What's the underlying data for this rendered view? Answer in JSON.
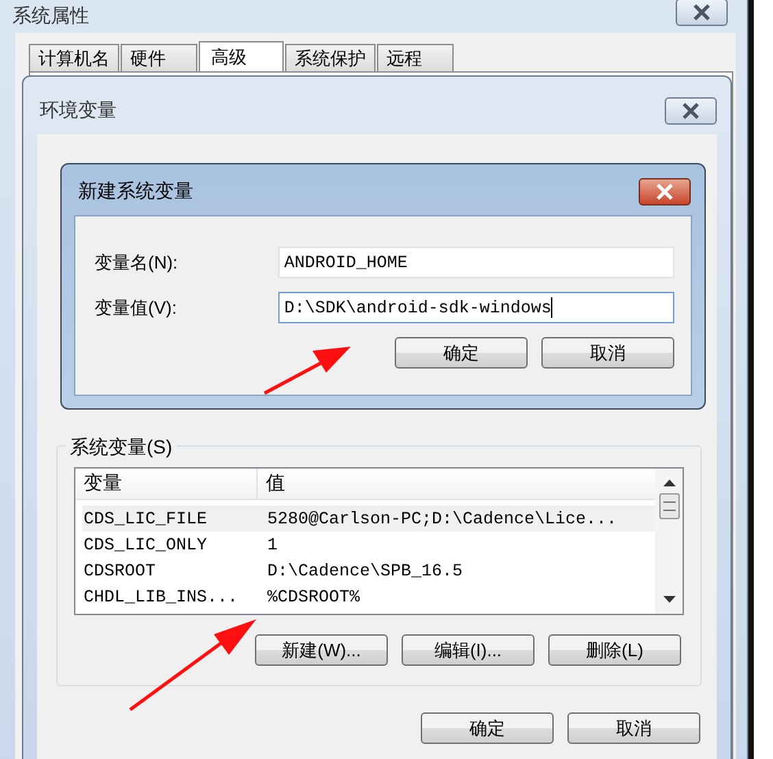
{
  "system_properties": {
    "title": "系统属性",
    "tabs": [
      {
        "label": "计算机名",
        "selected": false
      },
      {
        "label": "硬件",
        "selected": false
      },
      {
        "label": "高级",
        "selected": true
      },
      {
        "label": "系统保护",
        "selected": false
      },
      {
        "label": "远程",
        "selected": false
      }
    ]
  },
  "environment_variables": {
    "title": "环境变量",
    "system_variables": {
      "label": "系统变量(S)",
      "columns": [
        "变量",
        "值"
      ],
      "rows": [
        {
          "name": "CDS_LIC_FILE",
          "value": "5280@Carlson-PC;D:\\Cadence\\Lice...",
          "selected": true
        },
        {
          "name": "CDS_LIC_ONLY",
          "value": "1",
          "selected": false
        },
        {
          "name": "CDSROOT",
          "value": "D:\\Cadence\\SPB_16.5",
          "selected": false
        },
        {
          "name": "CHDL_LIB_INS...",
          "value": "%CDSROOT%",
          "selected": false
        }
      ],
      "buttons": [
        "新建(W)...",
        "编辑(I)...",
        "删除(L)"
      ]
    },
    "buttons": [
      "确定",
      "取消"
    ]
  },
  "new_variable_dialog": {
    "title": "新建系统变量",
    "fields": [
      {
        "label": "变量名(N):",
        "value": "ANDROID_HOME",
        "focused": false
      },
      {
        "label": "变量值(V):",
        "value": "D:\\SDK\\android-sdk-windows",
        "focused": true
      }
    ],
    "buttons": [
      "确定",
      "取消"
    ]
  }
}
